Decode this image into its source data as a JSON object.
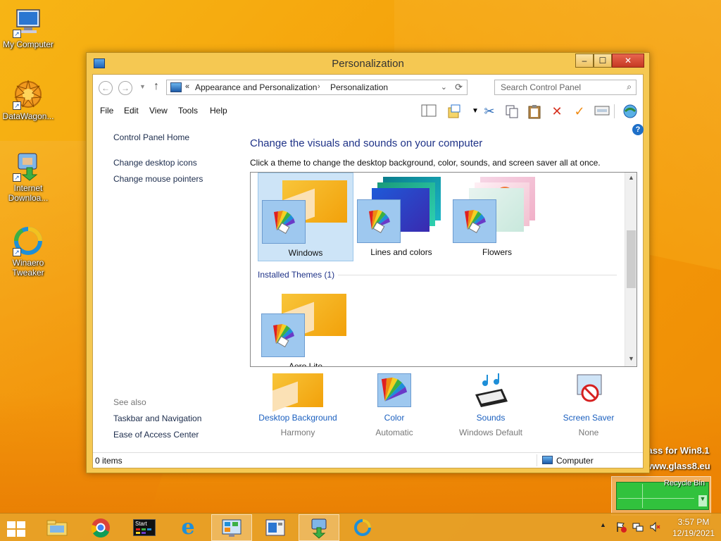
{
  "desktop": {
    "icons": [
      {
        "label": "My Computer"
      },
      {
        "label": "DataWagon..."
      },
      {
        "label": "Internet Downloa..."
      },
      {
        "label": "Winaero Tweaker"
      }
    ],
    "watermark_line1": "lass for Win8.1",
    "watermark_line2": "www.glass8.eu",
    "gadget_label": "Recycle Bin"
  },
  "window": {
    "title": "Personalization",
    "min_label": "–",
    "max_label": "☐",
    "close_label": "✕",
    "address": {
      "prefix": "«",
      "crumbs": [
        "Appearance and Personalization",
        "Personalization"
      ],
      "separator": "›"
    },
    "search_placeholder": "Search Control Panel",
    "menu": [
      "File",
      "Edit",
      "View",
      "Tools",
      "Help"
    ],
    "left_pane": {
      "home": "Control Panel Home",
      "links": [
        "Change desktop icons",
        "Change mouse pointers"
      ],
      "see_also": "See also",
      "see_also_links": [
        "Taskbar and Navigation",
        "Ease of Access Center"
      ]
    },
    "main": {
      "title": "Change the visuals and sounds on your computer",
      "description": "Click a theme to change the desktop background, color, sounds, and screen saver all at once.",
      "themes": [
        {
          "label": "Windows",
          "selected": true
        },
        {
          "label": "Lines and colors",
          "selected": false
        },
        {
          "label": "Flowers",
          "selected": false
        }
      ],
      "installed_label": "Installed Themes (1)",
      "installed_themes": [
        {
          "label": "Aero Lite"
        }
      ]
    },
    "bottom": [
      {
        "link": "Desktop Background",
        "sub": "Harmony"
      },
      {
        "link": "Color",
        "sub": "Automatic"
      },
      {
        "link": "Sounds",
        "sub": "Windows Default"
      },
      {
        "link": "Screen Saver",
        "sub": "None"
      }
    ],
    "status": {
      "items": "0 items",
      "location": "Computer"
    }
  },
  "taskbar": {
    "clock_time": "3:57 PM",
    "clock_date": "12/19/2021",
    "start_tile_label": "Start"
  }
}
